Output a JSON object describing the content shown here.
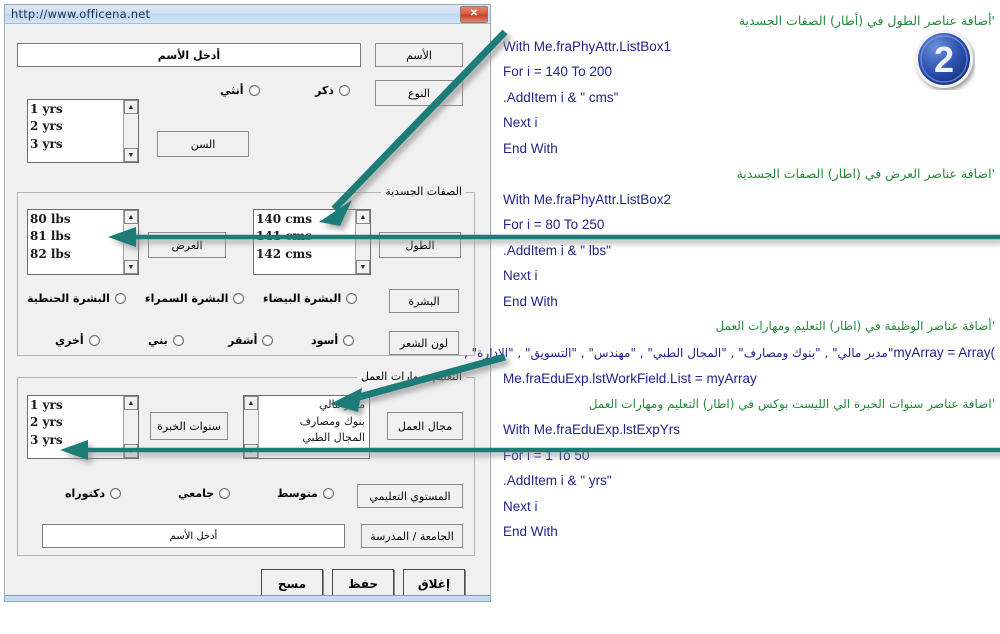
{
  "window": {
    "title": "http://www.officena.net",
    "close_icon": "close-icon",
    "close_label": "✕"
  },
  "form": {
    "name_label": "الأسم",
    "name_input_value": "أدخل الأسم",
    "gender_label": "النوع",
    "gender_options": [
      "ذكر",
      "أنثي"
    ],
    "age_label": "السن",
    "age_list_items": [
      "1 yrs",
      "2 yrs",
      "3 yrs"
    ],
    "physical_frame_title": "الصفات الجسدية",
    "weight_label": "العرض",
    "weight_list_items": [
      "80 lbs",
      "81 lbs",
      "82 lbs"
    ],
    "height_label": "الطول",
    "height_list_items": [
      "140 cms",
      "141 cms",
      "142 cms"
    ],
    "skin_label": "البشرة",
    "skin_options": [
      "البشرة البيضاء",
      "البشرة السمراء",
      "البشرة الحنطية"
    ],
    "hair_label": "لون الشعر",
    "hair_options": [
      "أسود",
      "أشقر",
      "بني",
      "أخري"
    ],
    "edu_frame_title": "التعليم ومهارات العمل",
    "workfield_label": "مجال العمل",
    "workfield_list_items": [
      "مدير مالي",
      "بنوك ومصارف",
      "المجال الطبي"
    ],
    "expyears_label": "سنوات الخبرة",
    "expyears_list_items": [
      "1 yrs",
      "2 yrs",
      "3 yrs"
    ],
    "edulevel_label": "المستوي التعليمي",
    "edulevel_options": [
      "متوسط",
      "جامعي",
      "دكتوراه"
    ],
    "school_label": "الجامعة / المدرسة",
    "school_input_value": "أدخل الأسم",
    "buttons": {
      "close": "إغلاق",
      "save": "حفظ",
      "clear": "مسح"
    },
    "scroll_up_glyph": "▲",
    "scroll_down_glyph": "▼"
  },
  "code": {
    "lines": [
      {
        "kind": "comment",
        "text": "'أضافة عناصر الطول في (أطار) الصفات الجسدية"
      },
      {
        "kind": "vb",
        "text": "With Me.fraPhyAttr.ListBox1"
      },
      {
        "kind": "vb",
        "text": "For i = 140 To 200"
      },
      {
        "kind": "vb",
        "text": ".AddItem i & \" cms\""
      },
      {
        "kind": "vb",
        "text": "Next i"
      },
      {
        "kind": "vb",
        "text": "End With"
      },
      {
        "kind": "comment",
        "text": "'اضافة عناصر العرض في (اطار) الصفات الجسدية"
      },
      {
        "kind": "vb",
        "text": "With Me.fraPhyAttr.ListBox2"
      },
      {
        "kind": "vb",
        "text": "For i = 80 To 250"
      },
      {
        "kind": "vb",
        "text": ".AddItem i & \" lbs\""
      },
      {
        "kind": "vb",
        "text": "Next i"
      },
      {
        "kind": "vb",
        "text": "End With"
      },
      {
        "kind": "comment",
        "text": "'أضافة عناصر الوظيفة في (اطار) التعليم ومهارات العمل"
      },
      {
        "kind": "mix",
        "en": "myArray = Array(",
        "ar": "\"مدير مالي\" , \"بنوك ومصارف\" , \"المجال الطبي\" , \"مهندس\" , \"التسويق\" , \"الإدارة\" ,"
      },
      {
        "kind": "vb",
        "text": "Me.fraEduExp.lstWorkField.List = myArray"
      },
      {
        "kind": "comment",
        "text": "'اضافة عناصر سنوات الخبرة الي الليست بوكس في (اطار) التعليم ومهارات العمل"
      },
      {
        "kind": "vb",
        "text": "With Me.fraEduExp.lstExpYrs"
      },
      {
        "kind": "vb",
        "text": "For i = 1 To 50"
      },
      {
        "kind": "vb",
        "text": ".AddItem i & \" yrs\""
      },
      {
        "kind": "vb",
        "text": "Next i"
      },
      {
        "kind": "vb",
        "text": "End With"
      }
    ]
  },
  "badge": {
    "number": "2"
  },
  "colors": {
    "arrow": "#1b7b77",
    "comment": "#248a3d",
    "code": "#232389",
    "badge": "#2c52b0",
    "titlebar": "#cfe0f3"
  }
}
